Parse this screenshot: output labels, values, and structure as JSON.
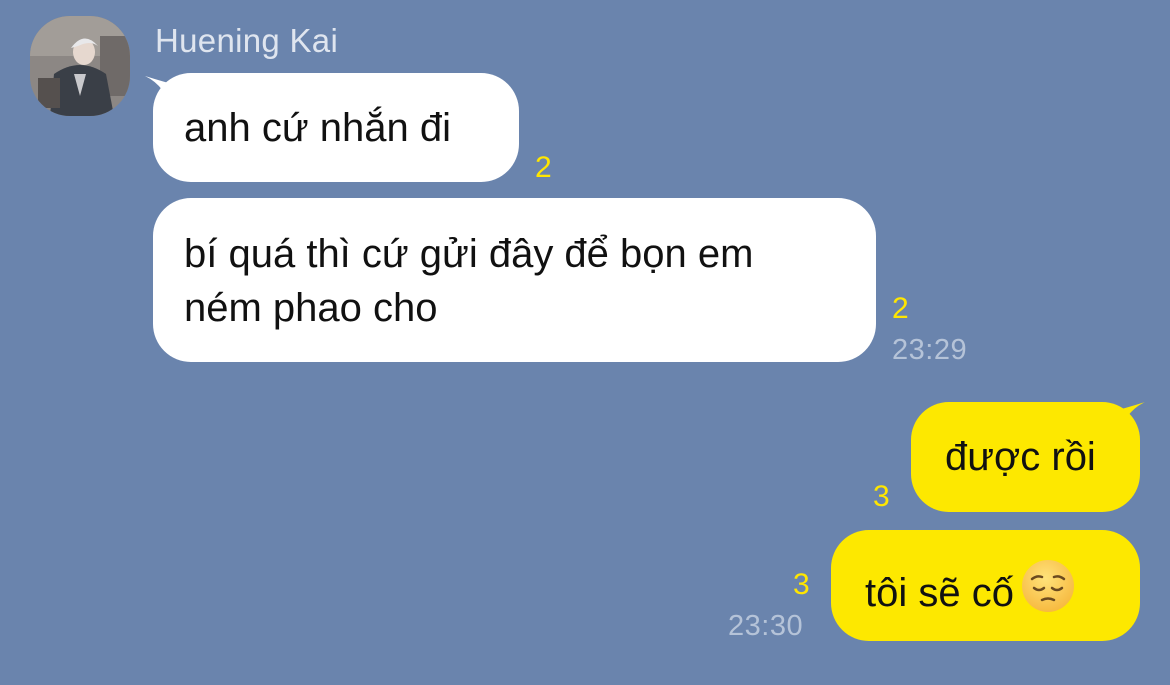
{
  "chat": {
    "sender_name": "Huening Kai",
    "messages": [
      {
        "text": "anh cứ nhắn đi",
        "read_count": "2"
      },
      {
        "text_line1": "bí quá thì cứ gửi đây để bọn em",
        "text_line2": "ném phao cho",
        "read_count": "2",
        "time": "23:29"
      },
      {
        "text": "được rồi",
        "read_count": "3"
      },
      {
        "text": "tôi sẽ cố",
        "emoji": "pensive-face",
        "read_count": "3",
        "time": "23:30"
      }
    ]
  },
  "colors": {
    "background": "#6a84ad",
    "incoming_bubble": "#ffffff",
    "outgoing_bubble": "#fde800",
    "read_count": "#ffe600",
    "timestamp": "#b5c3d8"
  }
}
